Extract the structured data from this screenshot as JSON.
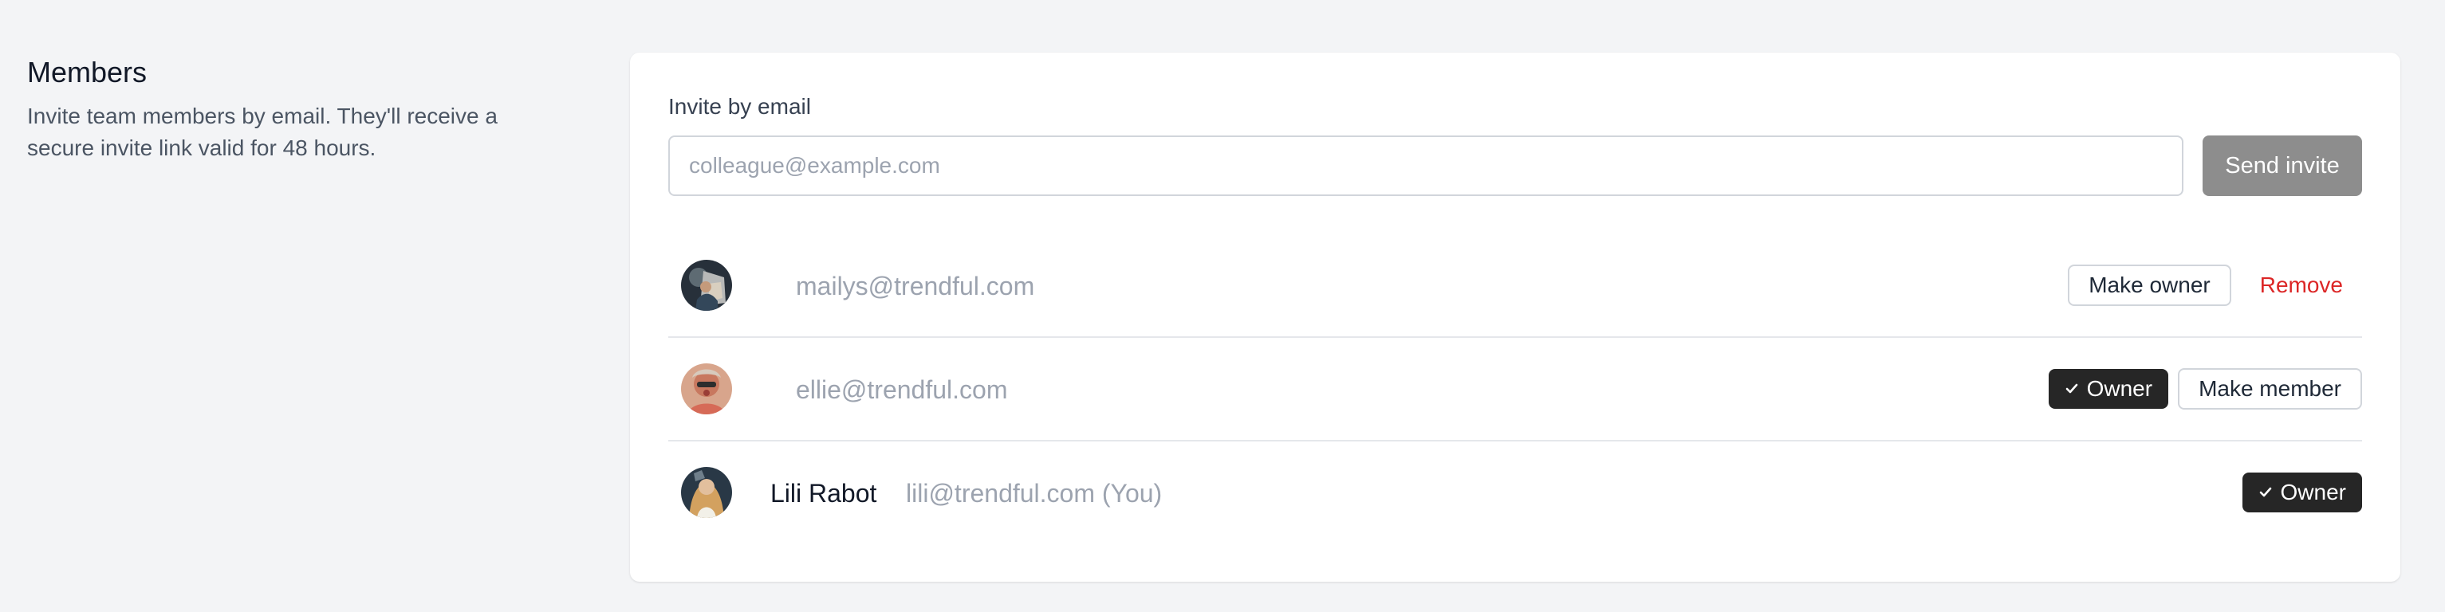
{
  "section": {
    "title": "Members",
    "description": "Invite team members by email. They'll receive a secure invite link valid for 48 hours."
  },
  "invite": {
    "label": "Invite by email",
    "value": "",
    "placeholder": "colleague@example.com",
    "send_label": "Send invite"
  },
  "members": [
    {
      "name": "",
      "email": "mailys@trendful.com",
      "avatar_icon": "user-avatar-photo",
      "make_owner_label": "Make owner",
      "remove_label": "Remove"
    },
    {
      "name": "",
      "email": "ellie@trendful.com",
      "avatar_icon": "user-avatar-photo",
      "owner_label": "Owner",
      "make_member_label": "Make member"
    },
    {
      "name": "Lili Rabot",
      "email": "lili@trendful.com (You)",
      "avatar_icon": "user-avatar-photo",
      "owner_label": "Owner"
    }
  ],
  "colors": {
    "background": "#f3f4f6",
    "card": "#ffffff",
    "send_button": "#8d8d8d",
    "owner_badge": "#262626",
    "remove_text": "#dc2626",
    "muted_text": "#9ca3af"
  }
}
